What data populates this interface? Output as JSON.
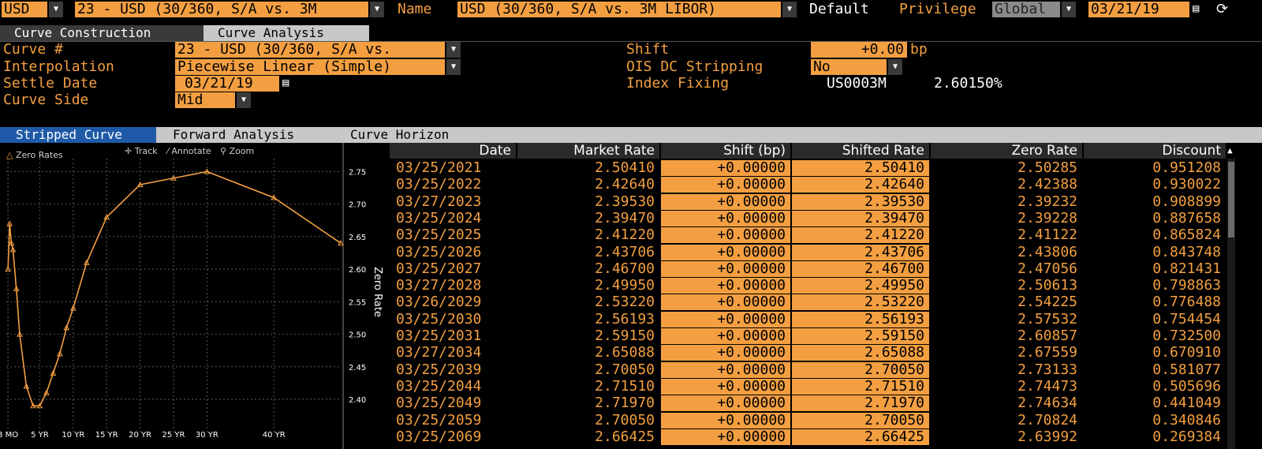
{
  "toolbar": {
    "currency": "USD",
    "curve_select": "23 - USD (30/360, S/A vs. 3M",
    "name_label": "Name",
    "name_value": "USD (30/360, S/A vs. 3M LIBOR)",
    "default_label": "Default",
    "privilege_label": "Privilege",
    "privilege_value": "Global",
    "date": "03/21/19"
  },
  "tabs": [
    "Curve Construction",
    "Curve Analysis"
  ],
  "form": {
    "curve_label": "Curve #",
    "curve_value": "23 - USD (30/360, S/A vs.",
    "interp_label": "Interpolation",
    "interp_value": "Piecewise Linear (Simple)",
    "settle_label": "Settle Date",
    "settle_value": "03/21/19",
    "side_label": "Curve Side",
    "side_value": "Mid",
    "shift_label": "Shift",
    "shift_value": "+0.00",
    "shift_unit": "bp",
    "ois_label": "OIS DC Stripping",
    "ois_value": "No",
    "index_label": "Index Fixing",
    "index_name": "US0003M",
    "index_value": "2.60150%"
  },
  "subtabs": [
    "Stripped Curve",
    "Forward Analysis",
    "Curve Horizon"
  ],
  "chart_tools": {
    "legend": "Zero Rates",
    "track": "Track",
    "annotate": "Annotate",
    "zoom": "Zoom"
  },
  "chart_data": {
    "type": "line",
    "legend": [
      "Zero Rates"
    ],
    "ylabel": "Zero Rate",
    "ylim": [
      2.36,
      2.77
    ],
    "y_ticks": [
      "2.75",
      "2.70",
      "2.65",
      "2.60",
      "2.55",
      "2.50",
      "2.45",
      "2.40"
    ],
    "x_ticks": [
      "3 MO",
      "5 YR",
      "10 YR",
      "15 YR",
      "20 YR",
      "25 YR",
      "30 YR",
      "40 YR"
    ],
    "x_ticks_years": [
      0.25,
      5,
      10,
      15,
      20,
      25,
      30,
      40
    ],
    "xlim": [
      0,
      50
    ],
    "series": [
      {
        "name": "Zero Rates",
        "x": [
          0.25,
          0.5,
          0.75,
          1,
          1.5,
          2,
          3,
          4,
          5,
          6,
          7,
          8,
          9,
          10,
          12,
          15,
          20,
          25,
          30,
          40,
          50
        ],
        "y": [
          2.6,
          2.67,
          2.64,
          2.63,
          2.57,
          2.5,
          2.42,
          2.39,
          2.39,
          2.41,
          2.44,
          2.47,
          2.51,
          2.54,
          2.61,
          2.68,
          2.73,
          2.74,
          2.75,
          2.71,
          2.64
        ]
      }
    ]
  },
  "table": {
    "headers": [
      "Date",
      "Market Rate",
      "Shift (bp)",
      "Shifted Rate",
      "Zero Rate",
      "Discount"
    ],
    "rows": [
      [
        "03/25/2021",
        "2.50410",
        "+0.00000",
        "2.50410",
        "2.50285",
        "0.951208"
      ],
      [
        "03/25/2022",
        "2.42640",
        "+0.00000",
        "2.42640",
        "2.42388",
        "0.930022"
      ],
      [
        "03/27/2023",
        "2.39530",
        "+0.00000",
        "2.39530",
        "2.39232",
        "0.908899"
      ],
      [
        "03/25/2024",
        "2.39470",
        "+0.00000",
        "2.39470",
        "2.39228",
        "0.887658"
      ],
      [
        "03/25/2025",
        "2.41220",
        "+0.00000",
        "2.41220",
        "2.41122",
        "0.865824"
      ],
      [
        "03/25/2026",
        "2.43706",
        "+0.00000",
        "2.43706",
        "2.43806",
        "0.843748"
      ],
      [
        "03/25/2027",
        "2.46700",
        "+0.00000",
        "2.46700",
        "2.47056",
        "0.821431"
      ],
      [
        "03/27/2028",
        "2.49950",
        "+0.00000",
        "2.49950",
        "2.50613",
        "0.798863"
      ],
      [
        "03/26/2029",
        "2.53220",
        "+0.00000",
        "2.53220",
        "2.54225",
        "0.776488"
      ],
      [
        "03/25/2030",
        "2.56193",
        "+0.00000",
        "2.56193",
        "2.57532",
        "0.754454"
      ],
      [
        "03/25/2031",
        "2.59150",
        "+0.00000",
        "2.59150",
        "2.60857",
        "0.732500"
      ],
      [
        "03/27/2034",
        "2.65088",
        "+0.00000",
        "2.65088",
        "2.67559",
        "0.670910"
      ],
      [
        "03/25/2039",
        "2.70050",
        "+0.00000",
        "2.70050",
        "2.73133",
        "0.581077"
      ],
      [
        "03/25/2044",
        "2.71510",
        "+0.00000",
        "2.71510",
        "2.74473",
        "0.505696"
      ],
      [
        "03/25/2049",
        "2.71970",
        "+0.00000",
        "2.71970",
        "2.74634",
        "0.441049"
      ],
      [
        "03/25/2059",
        "2.70050",
        "+0.00000",
        "2.70050",
        "2.70824",
        "0.340846"
      ],
      [
        "03/25/2069",
        "2.66425",
        "+0.00000",
        "2.66425",
        "2.63992",
        "0.269384"
      ]
    ]
  },
  "colors": {
    "accent": "#f39f41",
    "tab_active": "#1f5aa8",
    "background": "#000000"
  }
}
